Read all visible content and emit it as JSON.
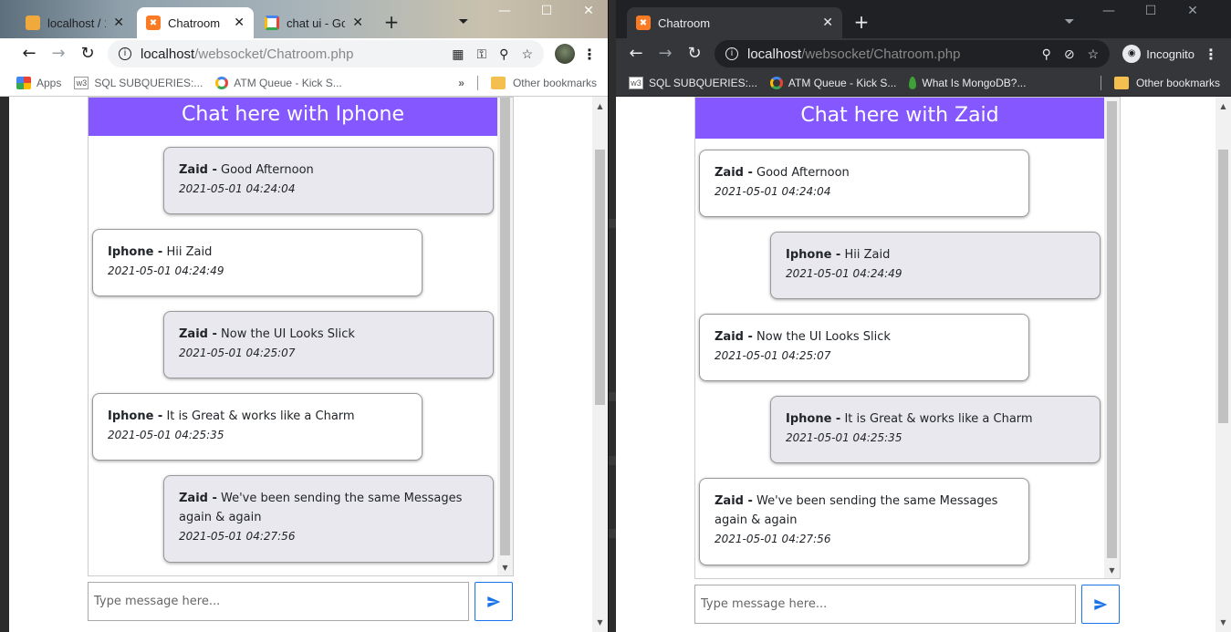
{
  "left_window": {
    "tabs": [
      {
        "label": "localhost / 1",
        "icon": "phpmyadmin-icon"
      },
      {
        "label": "Chatroom",
        "icon": "xampp-icon",
        "active": true
      },
      {
        "label": "chat ui - Go",
        "icon": "google-icon"
      }
    ],
    "url_host": "localhost",
    "url_path": "/websocket/Chatroom.php",
    "bookmarks": [
      {
        "label": "Apps",
        "icon": "apps-icon"
      },
      {
        "label": "SQL SUBQUERIES:...",
        "icon": "w3schools-icon"
      },
      {
        "label": "ATM Queue - Kick S...",
        "icon": "google-icon"
      }
    ],
    "bookmarks_more": "»",
    "other_bookmarks": "Other bookmarks",
    "chat": {
      "header": "Chat here with Iphone",
      "messages": [
        {
          "sender": "Zaid -",
          "text": " Good Afternoon",
          "time": "2021-05-01 04:24:04",
          "mine": true
        },
        {
          "sender": "Iphone -",
          "text": " Hii Zaid",
          "time": "2021-05-01 04:24:49",
          "mine": false
        },
        {
          "sender": "Zaid -",
          "text": " Now the UI Looks Slick",
          "time": "2021-05-01 04:25:07",
          "mine": true
        },
        {
          "sender": "Iphone -",
          "text": " It is Great & works like a Charm",
          "time": "2021-05-01 04:25:35",
          "mine": false
        },
        {
          "sender": "Zaid -",
          "text": " We've been sending the same Messages again & again",
          "time": "2021-05-01 04:27:56",
          "mine": true
        }
      ],
      "input_placeholder": "Type message here..."
    }
  },
  "right_window": {
    "tabs": [
      {
        "label": "Chatroom",
        "icon": "xampp-icon",
        "active": true
      }
    ],
    "url_host": "localhost",
    "url_path": "/websocket/Chatroom.php",
    "incognito_label": "Incognito",
    "bookmarks": [
      {
        "label": "SQL SUBQUERIES:...",
        "icon": "w3schools-icon"
      },
      {
        "label": "ATM Queue - Kick S...",
        "icon": "google-icon"
      },
      {
        "label": "What Is MongoDB?...",
        "icon": "mongodb-leaf-icon"
      }
    ],
    "other_bookmarks": "Other bookmarks",
    "chat": {
      "header": "Chat here with Zaid",
      "messages": [
        {
          "sender": "Zaid -",
          "text": " Good Afternoon",
          "time": "2021-05-01 04:24:04",
          "mine": false
        },
        {
          "sender": "Iphone -",
          "text": " Hii Zaid",
          "time": "2021-05-01 04:24:49",
          "mine": true
        },
        {
          "sender": "Zaid -",
          "text": " Now the UI Looks Slick",
          "time": "2021-05-01 04:25:07",
          "mine": false
        },
        {
          "sender": "Iphone -",
          "text": " It is Great & works like a Charm",
          "time": "2021-05-01 04:25:35",
          "mine": true
        },
        {
          "sender": "Zaid -",
          "text": " We've been sending the same Messages again & again",
          "time": "2021-05-01 04:27:56",
          "mine": false
        }
      ],
      "input_placeholder": "Type message here..."
    }
  },
  "colors": {
    "chat_header": "#8457ff",
    "own_bubble": "#e9e8ef",
    "other_bubble": "#ffffff",
    "send_icon": "#1a73e8"
  }
}
